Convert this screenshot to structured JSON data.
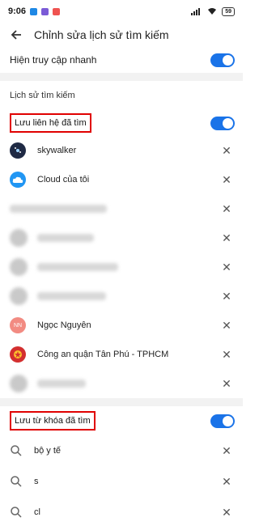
{
  "status": {
    "time": "9:06",
    "battery": "59",
    "app_colors": [
      "#1e88e5",
      "#7b5bd6",
      "#ef5350"
    ]
  },
  "header": {
    "title": "Chỉnh sửa lịch sử tìm kiếm"
  },
  "quick_access": {
    "label": "Hiện truy cập nhanh",
    "enabled": true
  },
  "history": {
    "title": "Lịch sử tìm kiếm"
  },
  "contacts_section": {
    "label": "Lưu liên hệ đã tìm",
    "enabled": true,
    "items": [
      {
        "name": "skywalker",
        "avatar_color": "#1f2a44",
        "avatar_icon": "galaxy-avatar"
      },
      {
        "name": "Cloud của tôi",
        "avatar_color": "#2196f3",
        "avatar_icon": "cloud-avatar"
      },
      {
        "name": "",
        "blurred": true
      },
      {
        "name": "",
        "blurred": true
      },
      {
        "name": "",
        "blurred": true
      },
      {
        "name": "",
        "blurred": true
      },
      {
        "name": "Ngọc Nguyên",
        "avatar_color": "#f28b82",
        "avatar_text": "NN"
      },
      {
        "name": "Công an quận Tân Phú - TPHCM",
        "avatar_color": "#d32f2f",
        "avatar_icon": "police-badge-avatar"
      },
      {
        "name": "",
        "blurred": true
      }
    ]
  },
  "keywords_section": {
    "label": "Lưu từ khóa đã tìm",
    "enabled": true,
    "items": [
      {
        "text": "bộ y tế"
      },
      {
        "text": "s"
      },
      {
        "text": "cl"
      }
    ]
  },
  "colors": {
    "accent": "#1a73e8",
    "highlight_border": "#e00000"
  }
}
